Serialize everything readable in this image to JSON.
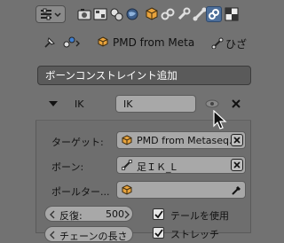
{
  "header": {
    "editor_icon": "properties-editor-icon",
    "tabs": [
      {
        "icon": "render-icon"
      },
      {
        "icon": "render-layers-icon"
      },
      {
        "icon": "scene-icon"
      },
      {
        "icon": "world-icon"
      },
      {
        "icon": "object-icon"
      },
      {
        "icon": "object-constraint-icon"
      },
      {
        "icon": "modifiers-icon"
      },
      {
        "icon": "bone-icon"
      },
      {
        "icon": "bone-constraint-icon",
        "active": true
      },
      {
        "icon": "texture-icon"
      }
    ]
  },
  "context": {
    "object_name": "PMD from Meta",
    "bone_name": "ひざ"
  },
  "add_constraint": {
    "label": "ボーンコンストレイント追加"
  },
  "constraint": {
    "type_label": "IK",
    "name": "IK",
    "fields": {
      "target_label": "ターゲット:",
      "target_value": "PMD from Metaseq...",
      "bone_label": "ボーン:",
      "bone_value": "足ＩＫ_L",
      "pole_label": "ポールター...",
      "pole_value": ""
    },
    "iterations_label": "反復:",
    "iterations_value": "500",
    "use_tail_label": "テールを使用",
    "use_tail_checked": true,
    "chain_label": "チェーンの長さ",
    "stretch_label": "ストレッチ",
    "stretch_checked": true
  },
  "colors": {
    "background": "#727272",
    "panel": "#6e6e6e",
    "field": "#a8a8a8",
    "active_tab": "#4e6f9a",
    "dropdown": "#5a5a5a",
    "object_orange": "#e8a33c"
  }
}
